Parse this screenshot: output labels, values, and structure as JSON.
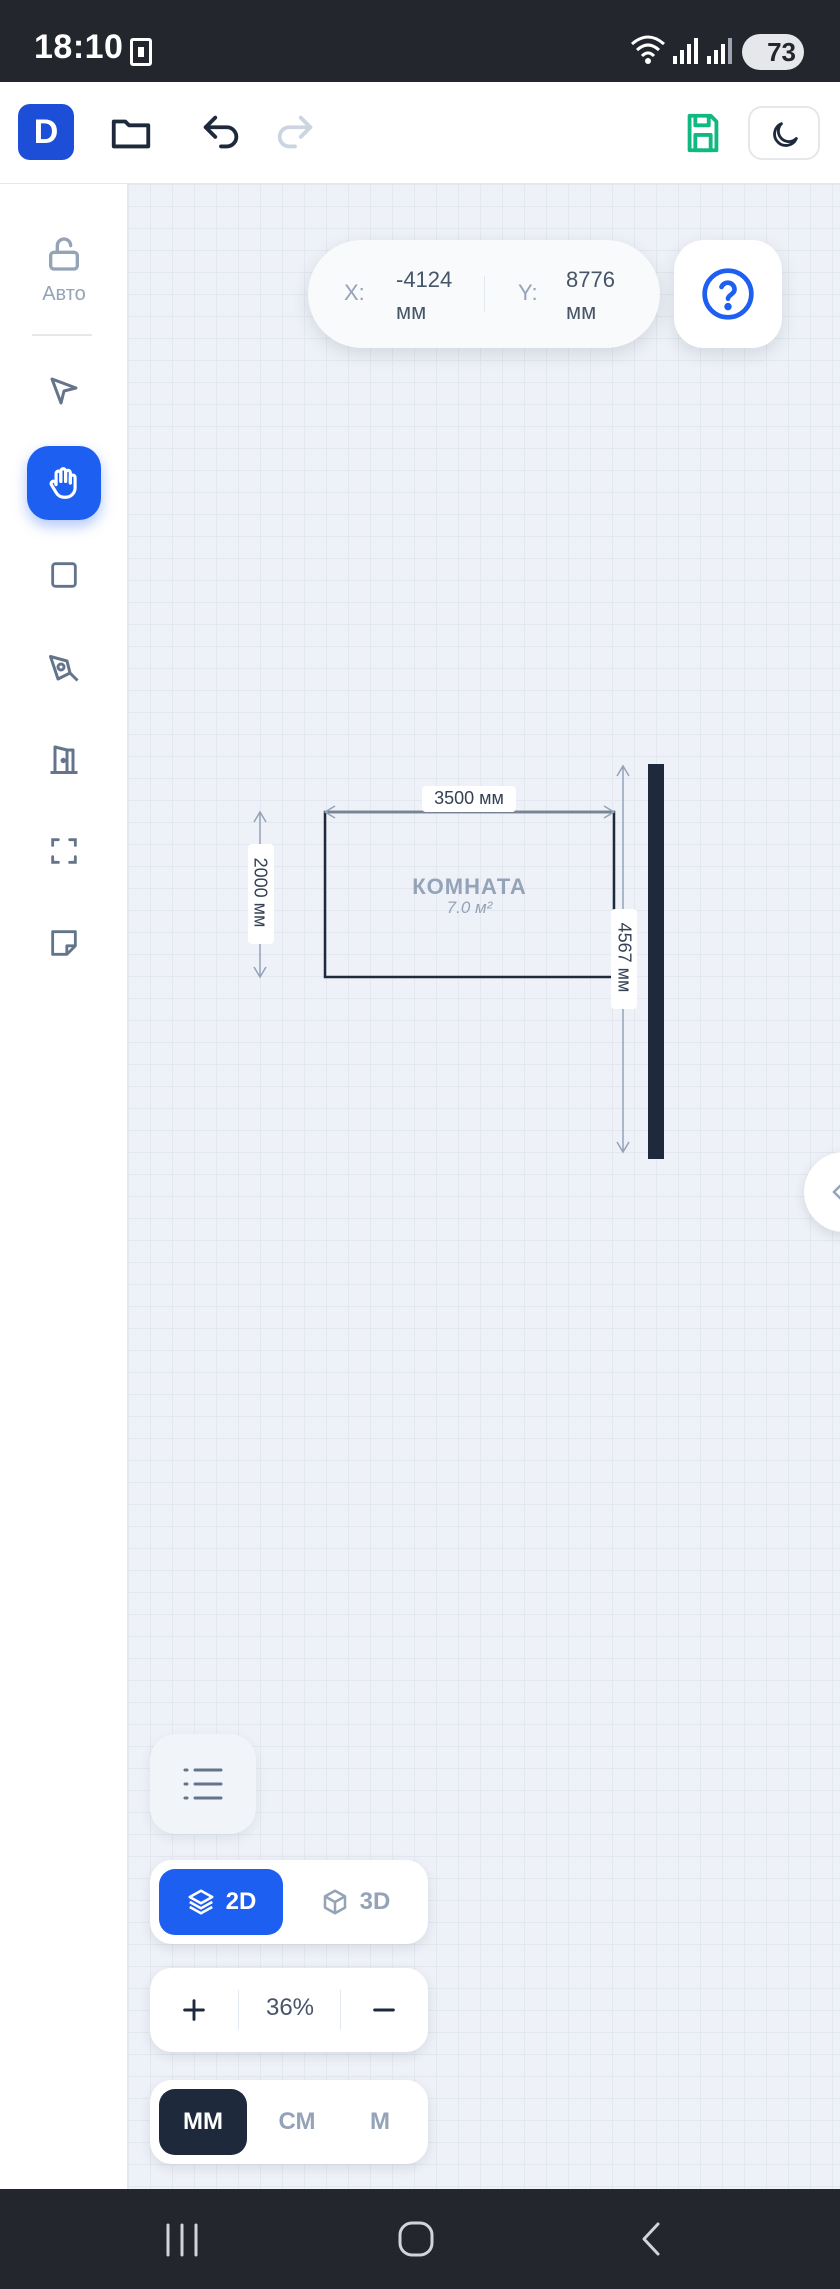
{
  "status_bar": {
    "time": "18:10",
    "battery": "73"
  },
  "toolbar": {
    "logo_letter": "D",
    "icons": [
      "folder-icon",
      "undo-icon",
      "redo-icon",
      "save-icon",
      "moon-icon"
    ]
  },
  "sidebar": {
    "lock_label": "Авто",
    "tools": [
      "pointer-icon",
      "hand-icon",
      "rectangle-icon",
      "pen-icon",
      "door-icon",
      "frame-icon",
      "note-icon"
    ],
    "active_tool": "hand-icon"
  },
  "coords": {
    "x_label": "X:",
    "x_value": "-4124",
    "x_unit": "мм",
    "y_label": "Y:",
    "y_value": "8776",
    "y_unit": "мм"
  },
  "room": {
    "name": "КОМНАТА",
    "area": "7.0 м²",
    "width_label": "3500 мм",
    "height_label": "2000 мм"
  },
  "wall": {
    "length_label": "4567 мм"
  },
  "view_toggle": {
    "option_2d": "2D",
    "option_3d": "3D",
    "selected": "2D"
  },
  "zoom": {
    "value": "36%"
  },
  "units": {
    "options": [
      "ММ",
      "СМ",
      "М"
    ],
    "selected": "ММ"
  },
  "colors": {
    "accent": "#1d5ff0",
    "save_green": "#10b981",
    "dark": "#1e293b"
  }
}
